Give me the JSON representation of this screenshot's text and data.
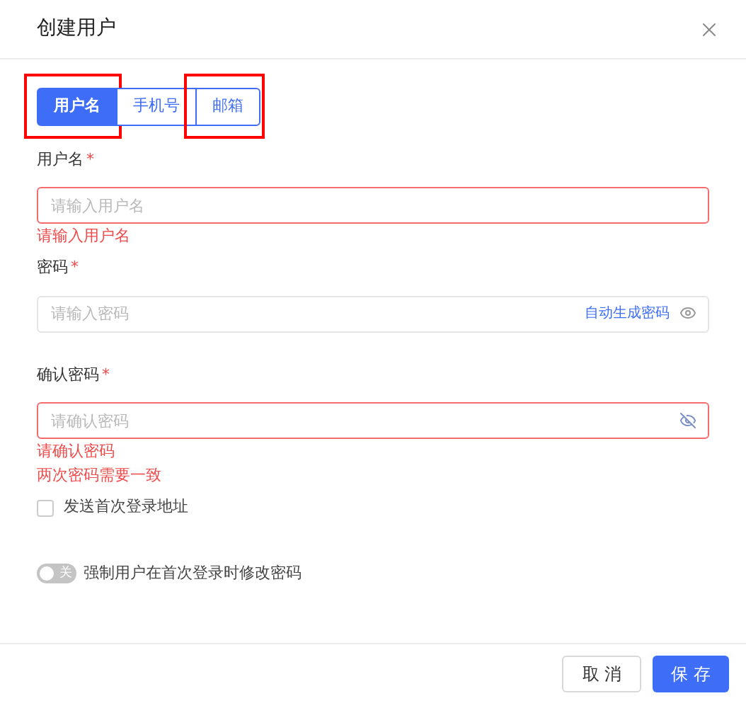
{
  "dialog": {
    "title": "创建用户"
  },
  "tabs": [
    {
      "label": "用户名",
      "selected": true,
      "highlighted": true
    },
    {
      "label": "手机号",
      "selected": false,
      "highlighted": false
    },
    {
      "label": "邮箱",
      "selected": false,
      "highlighted": true
    }
  ],
  "fields": [
    {
      "label": "用户名",
      "required_mark": "*",
      "placeholder": "请输入用户名",
      "invalid": true,
      "errors": [
        "请输入用户名"
      ]
    },
    {
      "label": "密码",
      "required_mark": "*",
      "placeholder": "请输入密码",
      "invalid": false,
      "action": "自动生成密码",
      "password_visible": true
    },
    {
      "label": "确认密码",
      "required_mark": "*",
      "placeholder": "请确认密码",
      "invalid": true,
      "password_visible": false,
      "errors": [
        "请确认密码",
        "两次密码需要一致"
      ]
    }
  ],
  "checkbox": {
    "label": "发送首次登录地址",
    "checked": false
  },
  "switch": {
    "state_label": "关",
    "on": false,
    "label": "强制用户在首次登录时修改密码"
  },
  "buttons": [
    {
      "label": "取 消",
      "kind": "secondary"
    },
    {
      "label": "保 存",
      "kind": "primary"
    }
  ]
}
